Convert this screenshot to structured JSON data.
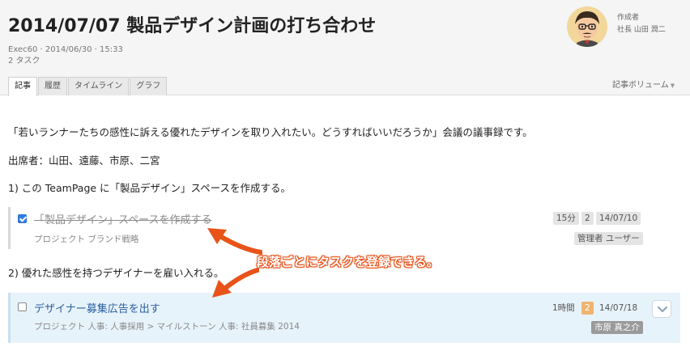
{
  "header": {
    "title": "2014/07/07 製品デザイン計画の打ち合わせ",
    "meta_line1": "Exec60 · 2014/06/30 · 15:33",
    "meta_line2": "2 タスク",
    "author_label": "作成者",
    "author_name": "社長 山田 潤二"
  },
  "tabs": [
    {
      "label": "記事",
      "active": true
    },
    {
      "label": "履歴",
      "active": false
    },
    {
      "label": "タイムライン",
      "active": false
    },
    {
      "label": "グラフ",
      "active": false
    }
  ],
  "volume_label": "記事ボリューム",
  "body": {
    "intro": "「若いランナーたちの感性に訴える優れたデザインを取り入れたい。どうすればいいだろうか」会議の議事録です。",
    "attendees": "出席者：山田、遠藤、市原、二宮",
    "item1": "1) この TeamPage に「製品デザイン」スペースを作成する。",
    "item2": "2) 優れた感性を持つデザイナーを雇い入れる。"
  },
  "tasks": [
    {
      "title": "「製品デザイン」スペースを作成する",
      "subtitle": "プロジェクト ブランド戦略",
      "completed": true,
      "estimate": "15分",
      "count": "2",
      "date": "14/07/10",
      "assignee": "管理者 ユーザー"
    },
    {
      "title": "デザイナー募集広告を出す",
      "subtitle": "プロジェクト 人事: 人事採用 > マイルストーン 人事: 社員募集 2014",
      "completed": false,
      "estimate": "1時間",
      "count": "2",
      "date": "14/07/18",
      "assignee": "市原 真之介"
    }
  ],
  "annotation": "段落ごとにタスクを登録できる。",
  "colors": {
    "accent_orange": "#e8531a",
    "task_highlight": "#e7f3fb",
    "link_blue": "#2a5f9e"
  }
}
